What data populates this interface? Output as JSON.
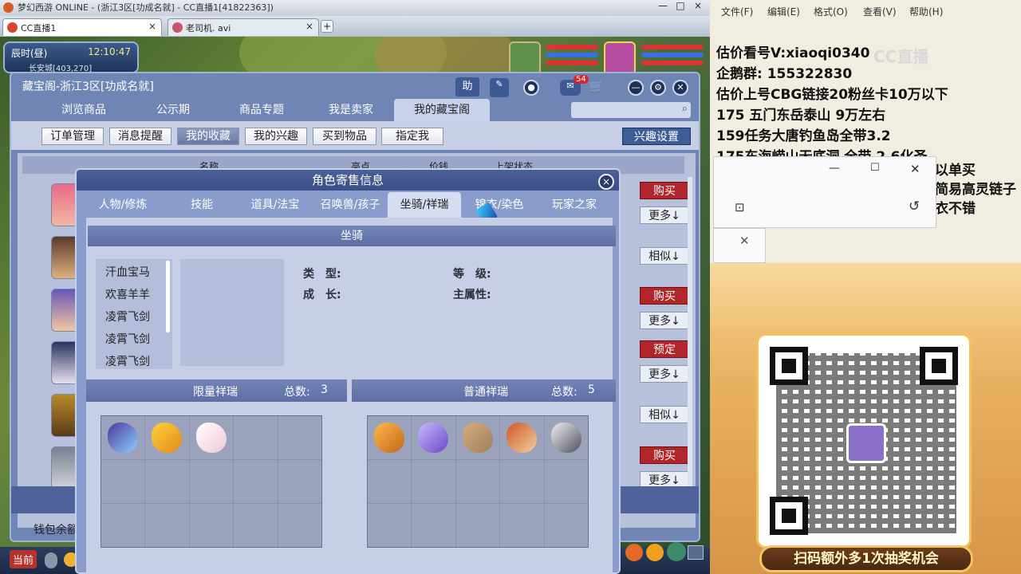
{
  "browser": {
    "title": "梦幻西游 ONLINE - (浙江3区[功成名就] - CC直播1[41822363])",
    "tabs": [
      {
        "label": "CC直播1",
        "close": "×"
      },
      {
        "label": "老司机. avi",
        "close": "×"
      }
    ],
    "new_tab": "+",
    "window_controls": [
      "—",
      "□",
      "×"
    ]
  },
  "hud": {
    "time_period": "辰时(昼)",
    "clock": "12:10:47",
    "location": "长安城[403,270]"
  },
  "panel": {
    "title": "藏宝阁-浙江3区[功成名就]",
    "help": "助",
    "message_badge": "54",
    "nav_tabs": [
      "浏览商品",
      "公示期",
      "商品专题",
      "我是卖家",
      "我的藏宝阁"
    ],
    "active_nav": "我的藏宝阁",
    "search_placeholder": "",
    "sub_buttons": [
      "订单管理",
      "消息提醒",
      "我的收藏",
      "我的兴趣",
      "买到物品",
      "指定我"
    ],
    "active_sub": "我的收藏",
    "interest_settings": "兴趣设置",
    "list_headers": [
      "名称",
      "亮点",
      "价钱",
      "上架状态"
    ],
    "actions": [
      {
        "label": "购买",
        "style": "red"
      },
      {
        "label": "更多↓",
        "style": "pale"
      },
      {
        "label": "相似↓",
        "style": "pale"
      },
      {
        "label": "购买",
        "style": "red"
      },
      {
        "label": "更多↓",
        "style": "pale"
      },
      {
        "label": "预定",
        "style": "red"
      },
      {
        "label": "更多↓",
        "style": "pale"
      },
      {
        "label": "相似↓",
        "style": "pale"
      },
      {
        "label": "购买",
        "style": "red"
      },
      {
        "label": "更多↓",
        "style": "pale"
      }
    ],
    "wallet_label": "钱包余额"
  },
  "taskbar": {
    "current_label": "当前"
  },
  "dialog": {
    "title": "角色寄售信息",
    "close": "×",
    "tabs": [
      "人物/修炼",
      "技能",
      "道具/法宝",
      "召唤兽/孩子",
      "坐骑/祥瑞",
      "锦衣/染色",
      "玩家之家"
    ],
    "active_tab": "坐骑/祥瑞",
    "mount_header": "坐骑",
    "mounts": [
      "汗血宝马",
      "欢喜羊羊",
      "凌霄飞剑",
      "凌霄飞剑",
      "凌霄飞剑"
    ],
    "attrs": {
      "type_label": "类　型:",
      "level_label": "等　级:",
      "growth_label": "成　长:",
      "main_attr_label": "主属性:"
    },
    "limited": {
      "label": "限量祥瑞",
      "total_label": "总数:",
      "total": "3"
    },
    "normal": {
      "label": "普通祥瑞",
      "total_label": "总数:",
      "total": "5"
    }
  },
  "notepad": {
    "menu": [
      "文件(F)",
      "编辑(E)",
      "格式(O)",
      "查看(V)",
      "帮助(H)"
    ],
    "lines": [
      "估价看号V:xiaoqi0340",
      "企鹅群: 155322830",
      "估价上号CBG链接20粉丝卡10万以下",
      "175 五门东岳泰山  9万左右",
      "159任务大唐钓鱼岛全带3.2",
      "175东海崂山无底洞  全带   2.6化圣"
    ],
    "partial_lines": [
      "以单买",
      "简易高灵链子",
      "衣不错"
    ],
    "watermark": "CC直播"
  },
  "promo": {
    "banner": "扫码额外多1次抽奖机会"
  },
  "colors": {
    "panel_bg": "#6f85b3",
    "accent_red": "#b0262b",
    "dialog_tab_active": "#d6ddf0"
  }
}
